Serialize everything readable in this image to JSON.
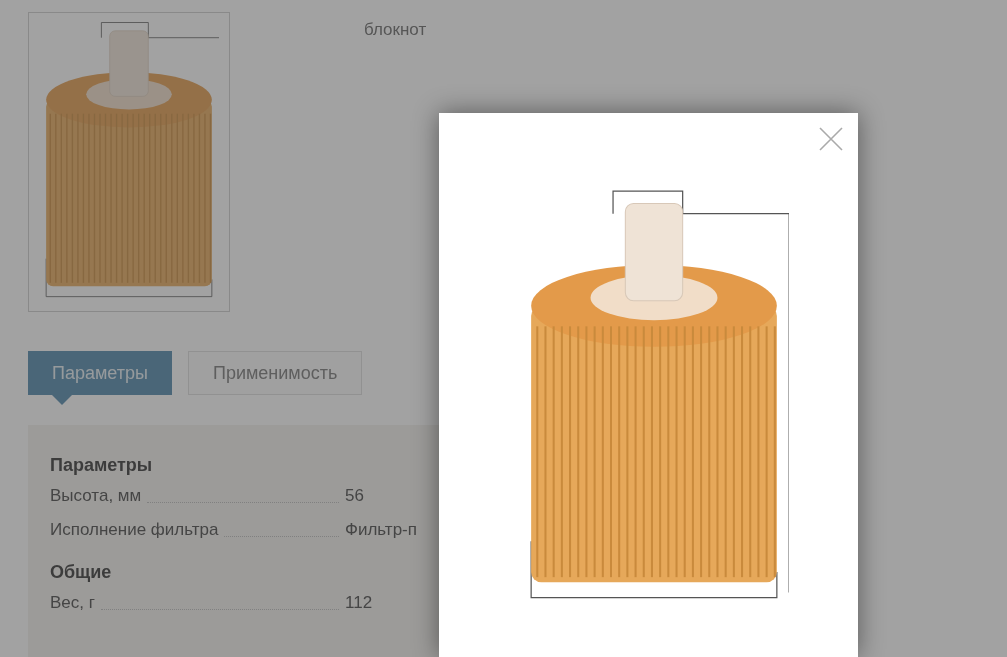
{
  "page": {
    "note": "блокнот"
  },
  "tabs": [
    {
      "label": "Параметры",
      "selected": true
    },
    {
      "label": "Применимость",
      "selected": false
    }
  ],
  "params": {
    "groups": [
      {
        "title": "Параметры",
        "rows": [
          {
            "label": "Высота, мм",
            "value": "56"
          },
          {
            "label": "Исполнение фильтра",
            "value": "Фильтр-п"
          }
        ]
      },
      {
        "title": "Общие",
        "rows": [
          {
            "label": "Вес, г",
            "value": "112"
          }
        ]
      }
    ]
  }
}
